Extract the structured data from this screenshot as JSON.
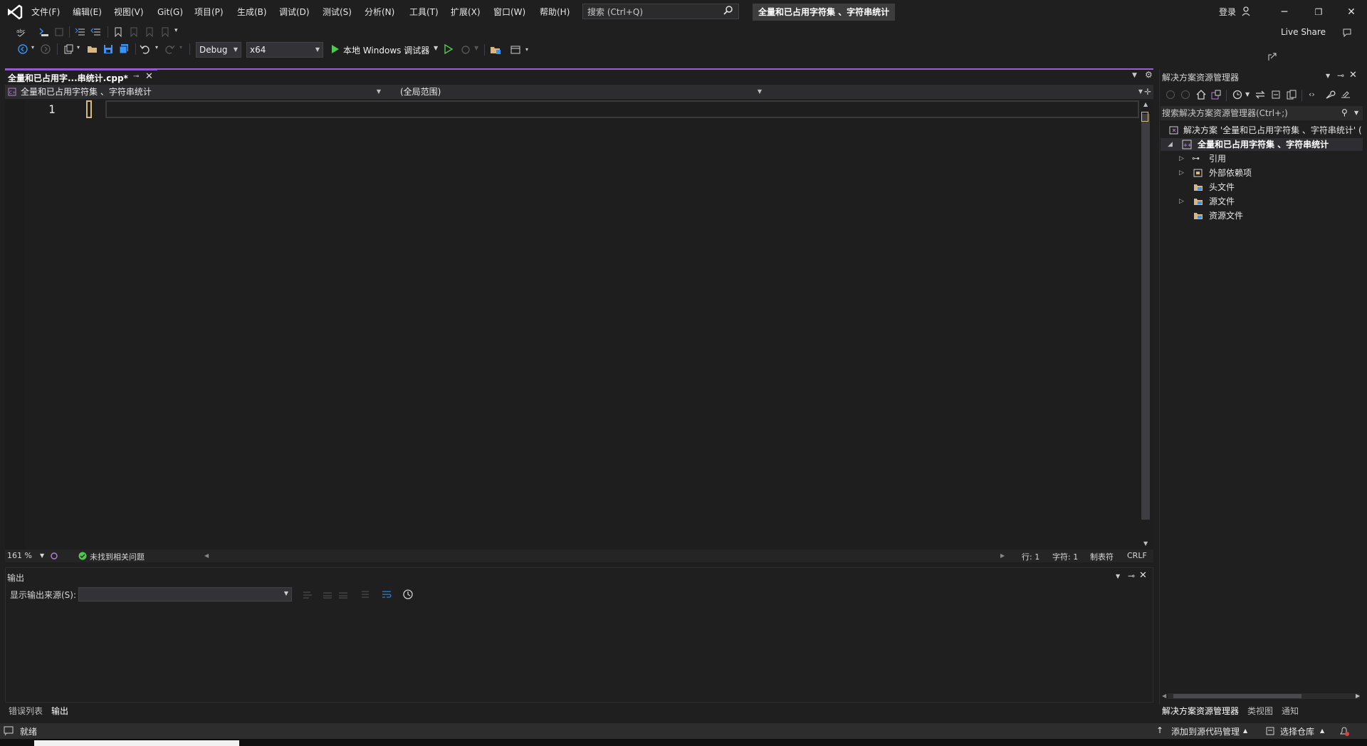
{
  "menubar": {
    "items": [
      "文件(F)",
      "编辑(E)",
      "视图(V)",
      "Git(G)",
      "项目(P)",
      "生成(B)",
      "调试(D)",
      "测试(S)",
      "分析(N)",
      "工具(T)",
      "扩展(X)",
      "窗口(W)",
      "帮助(H)"
    ],
    "search_placeholder": "搜索 (Ctrl+Q)",
    "solution_name": "全量和已占用字符集 、字符串统计",
    "login": "登录"
  },
  "window_controls": {
    "minimize": "─",
    "restore": "❐",
    "close": "✕"
  },
  "toolbar": {
    "config": "Debug",
    "platform": "x64",
    "debugger": "本地 Windows 调试器",
    "live_share": "Live Share"
  },
  "document": {
    "tab_label": "全量和已占用字...串统计.cpp*",
    "nav_project": "全量和已占用字符集 、字符串统计",
    "nav_scope": "(全局范围)",
    "nav_member": "",
    "line_number": "1"
  },
  "editor_status": {
    "zoom": "161 %",
    "issues": "未找到相关问题",
    "line": "行: 1",
    "char": "字符: 1",
    "indent": "制表符",
    "eol": "CRLF"
  },
  "output": {
    "title": "输出",
    "source_label": "显示输出来源(S):",
    "source_value": ""
  },
  "bottom_tabs": [
    "错误列表",
    "输出"
  ],
  "solution_explorer": {
    "title": "解决方案资源管理器",
    "search_placeholder": "搜索解决方案资源管理器(Ctrl+;)",
    "solution_row": "解决方案 '全量和已占用字符集 、字符串统计' (",
    "project_row": "全量和已占用字符集 、字符串统计",
    "nodes": [
      "引用",
      "外部依赖项",
      "头文件",
      "源文件",
      "资源文件"
    ],
    "tabs": [
      "解决方案资源管理器",
      "类视图",
      "通知"
    ]
  },
  "statusbar": {
    "ready": "就绪",
    "add_source_control": "添加到源代码管理",
    "select_repo": "选择仓库"
  },
  "colors": {
    "accent": "#8c5bd0",
    "background": "#1f1f1f",
    "caret": "#d7ba7d"
  }
}
